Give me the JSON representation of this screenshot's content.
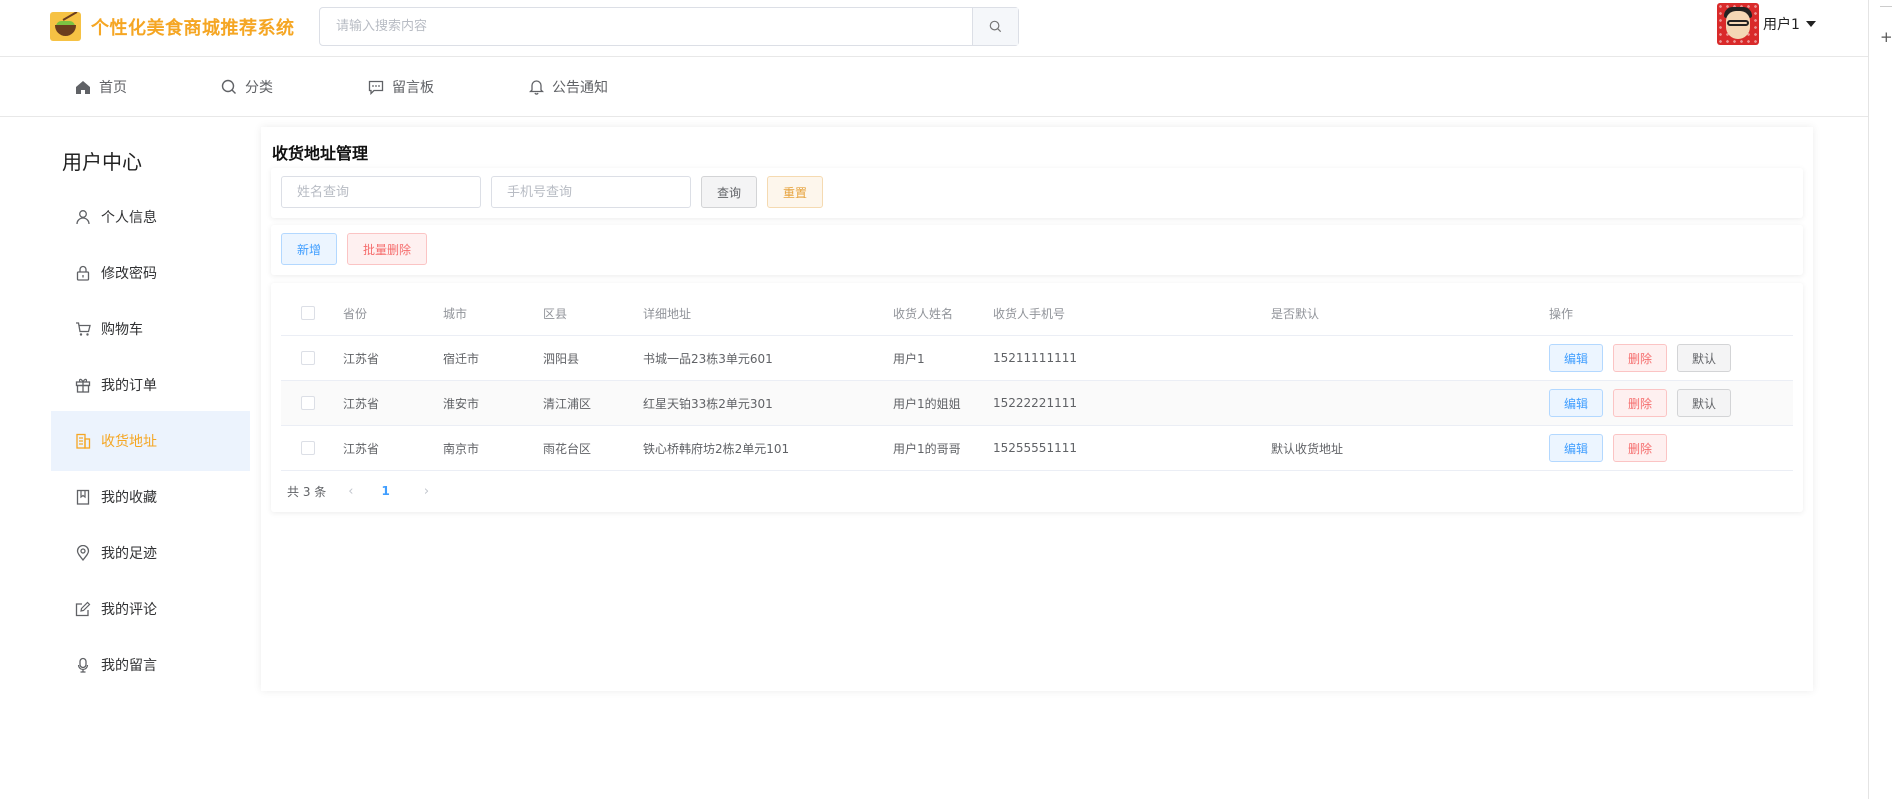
{
  "header": {
    "app_title": "个性化美食商城推荐系统",
    "logo_icon": "food-bowl-logo",
    "search": {
      "placeholder": "请输入搜索内容",
      "value": ""
    },
    "user": {
      "name": "用户1"
    }
  },
  "nav": {
    "items": [
      {
        "label": "首页",
        "icon": "home-icon"
      },
      {
        "label": "分类",
        "icon": "search-icon"
      },
      {
        "label": "留言板",
        "icon": "message-icon"
      },
      {
        "label": "公告通知",
        "icon": "bell-icon"
      }
    ]
  },
  "sidebar": {
    "title": "用户中心",
    "items": [
      {
        "label": "个人信息",
        "icon": "user-icon"
      },
      {
        "label": "修改密码",
        "icon": "lock-icon"
      },
      {
        "label": "购物车",
        "icon": "cart-icon"
      },
      {
        "label": "我的订单",
        "icon": "gift-icon"
      },
      {
        "label": "收货地址",
        "icon": "building-icon",
        "active": true
      },
      {
        "label": "我的收藏",
        "icon": "bookmark-icon"
      },
      {
        "label": "我的足迹",
        "icon": "location-icon"
      },
      {
        "label": "我的评论",
        "icon": "edit-icon"
      },
      {
        "label": "我的留言",
        "icon": "microphone-icon"
      }
    ]
  },
  "main": {
    "title": "收货地址管理",
    "filters": {
      "name_placeholder": "姓名查询",
      "phone_placeholder": "手机号查询",
      "query_label": "查询",
      "reset_label": "重置"
    },
    "actions": {
      "add_label": "新增",
      "batch_delete_label": "批量删除"
    },
    "table": {
      "columns": [
        "省份",
        "城市",
        "区县",
        "详细地址",
        "收货人姓名",
        "收货人手机号",
        "是否默认",
        "操作"
      ],
      "rows": [
        {
          "province": "江苏省",
          "city": "宿迁市",
          "district": "泗阳县",
          "address": "书城一品23栋3单元601",
          "name": "用户1",
          "phone": "15211111111",
          "default": "",
          "actions": [
            "编辑",
            "删除",
            "默认"
          ]
        },
        {
          "province": "江苏省",
          "city": "淮安市",
          "district": "清江浦区",
          "address": "红星天铂33栋2单元301",
          "name": "用户1的姐姐",
          "phone": "15222221111",
          "default": "",
          "actions": [
            "编辑",
            "删除",
            "默认"
          ]
        },
        {
          "province": "江苏省",
          "city": "南京市",
          "district": "雨花台区",
          "address": "铁心桥韩府坊2栋2单元101",
          "name": "用户1的哥哥",
          "phone": "15255551111",
          "default": "默认收货地址",
          "actions": [
            "编辑",
            "删除"
          ]
        }
      ]
    },
    "pagination": {
      "total_text": "共 3 条",
      "current_page": "1",
      "prev_symbol": "‹",
      "next_symbol": "›"
    }
  },
  "colors": {
    "brand": "#f5a623",
    "primary": "#409eff",
    "danger": "#f56c6c",
    "active_bg": "#ecf3fd"
  }
}
